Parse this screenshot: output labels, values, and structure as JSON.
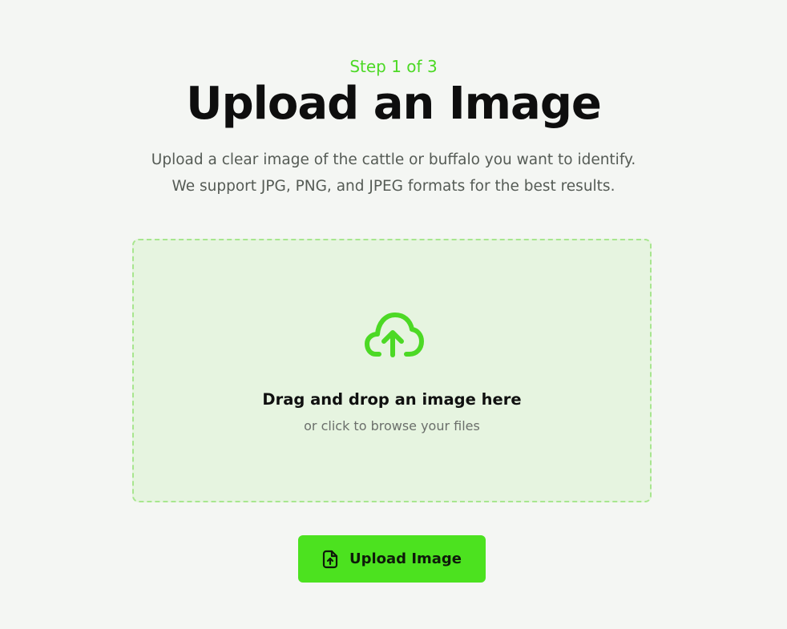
{
  "header": {
    "step": "Step 1 of 3",
    "title": "Upload an Image",
    "description_lines": [
      "Upload a clear image of the cattle or buffalo you want to identify.",
      "We support JPG, PNG, and JPEG formats for the best results."
    ]
  },
  "dropzone": {
    "icon": "cloud-upload-icon",
    "title": "Drag and drop an image here",
    "subtitle": "or click to browse your files"
  },
  "upload_button": {
    "icon": "file-upload-icon",
    "label": "Upload Image"
  },
  "colors": {
    "accent": "#4ce21f",
    "page_background": "#f4f6f3",
    "dropzone_background": "#e6f4e0",
    "dropzone_border": "#a8e68f"
  }
}
